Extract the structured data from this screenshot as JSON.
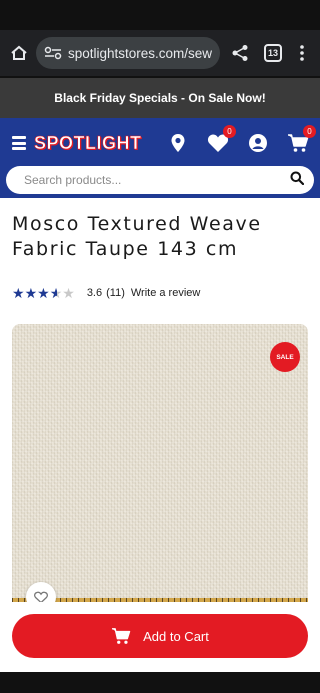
{
  "browser": {
    "url": "spotlightstores.com/sew",
    "tab_count": "13"
  },
  "promo": {
    "text": "Black Friday Specials - On Sale Now!"
  },
  "header": {
    "logo_text": "SPOTLIGHT",
    "wishlist_count": "0",
    "cart_count": "0",
    "brand_color": "#1f3a93",
    "accent_color": "#e31b23"
  },
  "search": {
    "placeholder": "Search products..."
  },
  "product": {
    "title": "Mosco Textured Weave Fabric Taupe 143 cm",
    "rating": 3.6,
    "rating_text": "3.6",
    "review_count": "(11)",
    "write_review": "Write a review",
    "sale_badge": "SALE"
  },
  "cart": {
    "button_label": "Add to Cart"
  }
}
